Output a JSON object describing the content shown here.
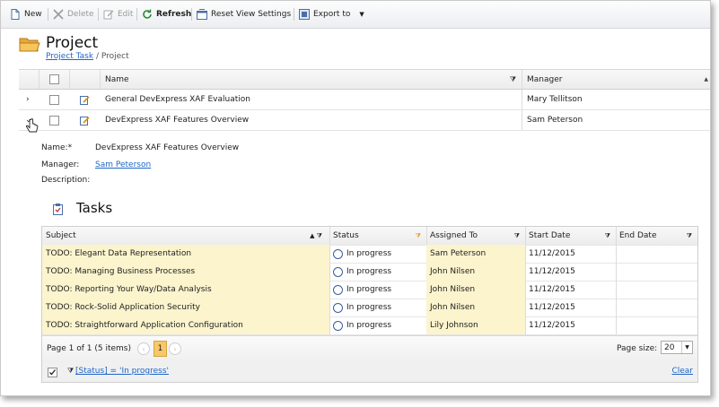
{
  "toolbar": {
    "new": "New",
    "delete": "Delete",
    "edit": "Edit",
    "refresh": "Refresh",
    "reset_view": "Reset View Settings",
    "export": "Export to"
  },
  "header": {
    "title": "Project",
    "breadcrumb_link": "Project Task",
    "breadcrumb_sep": " / ",
    "breadcrumb_current": "Project"
  },
  "grid": {
    "columns": [
      "Name",
      "Manager"
    ],
    "rows": [
      {
        "name": "General DevExpress XAF Evaluation",
        "manager": "Mary Tellitson"
      },
      {
        "name": "DevExpress XAF Features Overview",
        "manager": "Sam Peterson"
      }
    ]
  },
  "detail": {
    "name_label": "Name:*",
    "name_value": "DevExpress XAF Features Overview",
    "manager_label": "Manager:",
    "manager_value": "Sam Peterson",
    "description_label": "Description:"
  },
  "tasks": {
    "title": "Tasks",
    "columns": [
      "Subject",
      "Status",
      "Assigned To",
      "Start Date",
      "End Date"
    ],
    "rows": [
      {
        "subject": "TODO: Elegant Data Representation",
        "status": "In progress",
        "assigned": "Sam Peterson",
        "start": "11/12/2015",
        "end": ""
      },
      {
        "subject": "TODO: Managing Business Processes",
        "status": "In progress",
        "assigned": "John Nilsen",
        "start": "11/12/2015",
        "end": ""
      },
      {
        "subject": "TODO: Reporting Your Way/Data Analysis",
        "status": "In progress",
        "assigned": "John Nilsen",
        "start": "11/12/2015",
        "end": ""
      },
      {
        "subject": "TODO: Rock-Solid Application Security",
        "status": "In progress",
        "assigned": "John Nilsen",
        "start": "11/12/2015",
        "end": ""
      },
      {
        "subject": "TODO: Straightforward Application Configuration",
        "status": "In progress",
        "assigned": "Lily Johnson",
        "start": "11/12/2015",
        "end": ""
      }
    ],
    "pager_summary": "Page 1 of 1 (5 items)",
    "current_page": "1",
    "page_size_label": "Page size:",
    "page_size": "20",
    "filter_text": "[Status] = 'In progress'",
    "clear": "Clear"
  }
}
